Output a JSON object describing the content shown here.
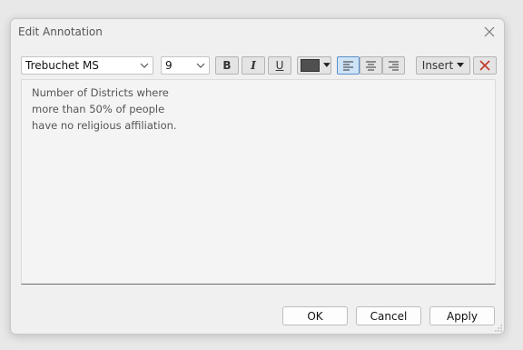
{
  "dialog": {
    "title": "Edit Annotation"
  },
  "toolbar": {
    "font_family": "Trebuchet MS",
    "font_size": "9",
    "bold_label": "B",
    "italic_label": "I",
    "underline_label": "U",
    "text_color": "#505050",
    "insert_label": "Insert"
  },
  "editor": {
    "lines": [
      "Number of Districts where",
      "more than 50% of people",
      "have no religious affiliation."
    ]
  },
  "buttons": {
    "ok": "OK",
    "cancel": "Cancel",
    "apply": "Apply"
  },
  "colors": {
    "accent": "#5a8fc8",
    "delete": "#c0392b"
  }
}
